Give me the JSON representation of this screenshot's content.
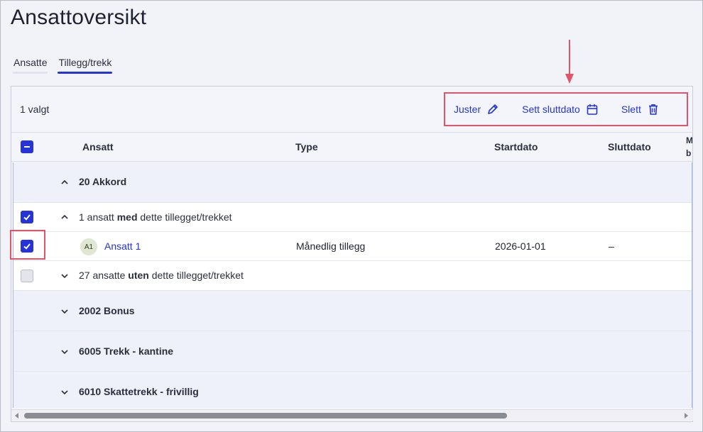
{
  "page": {
    "title": "Ansattoversikt"
  },
  "tabs": [
    {
      "label": "Ansatte",
      "active": false
    },
    {
      "label": "Tillegg/trekk",
      "active": true
    }
  ],
  "toolbar": {
    "selected_count": "1 valgt",
    "actions": [
      {
        "label": "Juster",
        "icon": "pencil-icon"
      },
      {
        "label": "Sett sluttdato",
        "icon": "calendar-icon"
      },
      {
        "label": "Slett",
        "icon": "trash-icon"
      }
    ]
  },
  "columns": {
    "ansatt": "Ansatt",
    "type": "Type",
    "startdato": "Startdato",
    "sluttdato": "Sluttdato",
    "cut_line1": "M",
    "cut_line2": "b"
  },
  "rows": {
    "group1": "20 Akkord",
    "with_prefix": "1 ansatt ",
    "with_bold": "med",
    "with_suffix": " dette tillegget/trekket",
    "employee": {
      "initials": "A1",
      "name": "Ansatt 1",
      "type": "Månedlig tillegg",
      "start": "2026-01-01",
      "end": "–"
    },
    "without_prefix": "27 ansatte ",
    "without_bold": "uten",
    "without_suffix": " dette tillegget/trekket",
    "group2": "2002 Bonus",
    "group3": "6005 Trekk - kantine",
    "group4": "6010 Skattetrekk - frivillig"
  },
  "colors": {
    "accent": "#2434d6",
    "highlight": "#e05568"
  }
}
